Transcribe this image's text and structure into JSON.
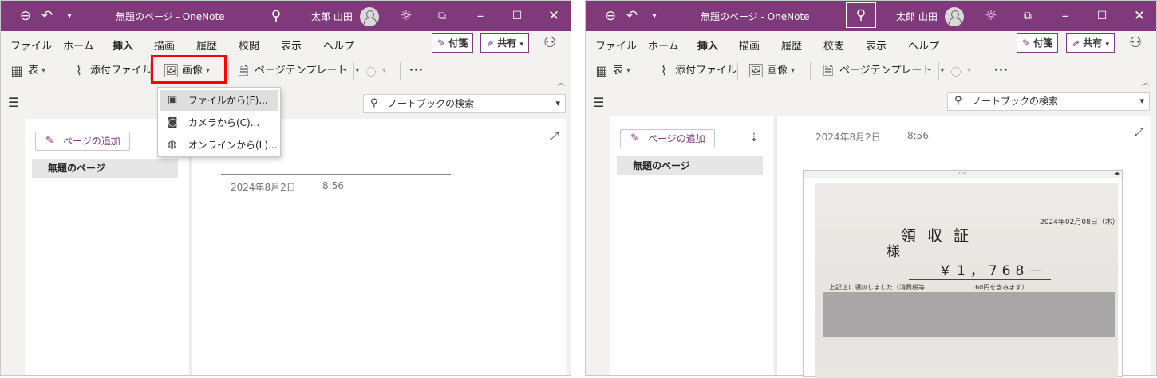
{
  "window": {
    "title": "無題のページ  -  OneNote",
    "user_name": "太郎 山田"
  },
  "menu": {
    "items": [
      "ファイル",
      "ホーム",
      "挿入",
      "描画",
      "履歴",
      "校閲",
      "表示",
      "ヘルプ"
    ],
    "active": "挿入",
    "sticky_notes": "付箋",
    "share": "共有"
  },
  "ribbon": {
    "table": "表",
    "attach_file": "添付ファイル",
    "image": "画像",
    "page_template": "ページテンプレート",
    "more": "···"
  },
  "image_menu": {
    "items": [
      "ファイルから(F)...",
      "カメラから(C)...",
      "オンラインから(L)..."
    ]
  },
  "navigation": {
    "search_placeholder": "ノートブックの検索"
  },
  "pages": {
    "add_page": "ページの追加",
    "items": [
      "無題のページ"
    ]
  },
  "page": {
    "date": "2024年8月2日",
    "time": "8:56"
  },
  "receipt": {
    "date": "2024年02月08日（木）",
    "title": "領収証",
    "addressee_suffix": "様",
    "amount": "￥1，768－",
    "note": "上記正に領収しました（消費税等",
    "tax_note": "160円を含みます）"
  },
  "colors": {
    "accent": "#80397b",
    "highlight_border": "#ff0000"
  },
  "icons": [
    "back-icon",
    "undo-icon",
    "customize-icon",
    "search-icon",
    "lightbulb-icon",
    "fullscreen-icon",
    "minimize-icon",
    "maximize-icon",
    "close-icon",
    "table-icon",
    "attachment-icon",
    "image-icon",
    "template-icon",
    "ink-icon",
    "hamburger-icon",
    "expand-icon",
    "sort-icon"
  ]
}
